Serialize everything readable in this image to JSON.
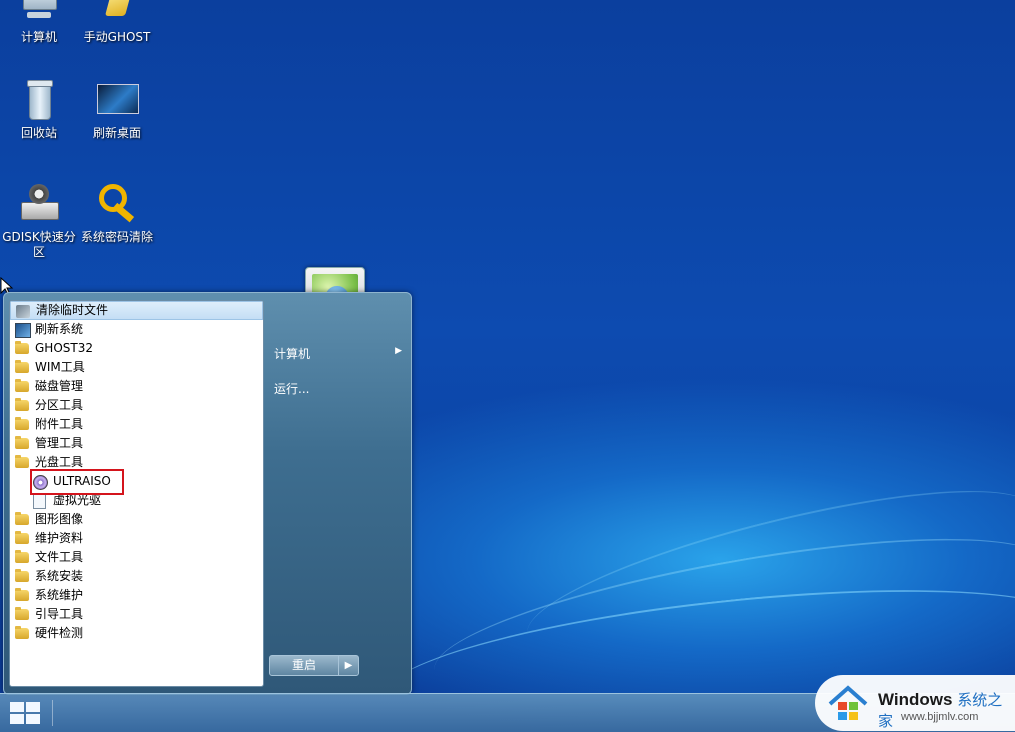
{
  "desktop": {
    "icons": [
      {
        "label": "计算机"
      },
      {
        "label": "手动GHOST"
      },
      {
        "label": "回收站"
      },
      {
        "label": "刷新桌面"
      },
      {
        "label": "GDISK快速分区"
      },
      {
        "label": "系统密码清除"
      }
    ]
  },
  "start_menu": {
    "programs": [
      {
        "label": "清除临时文件",
        "icon": "broom-icon",
        "highlighted": true
      },
      {
        "label": "刷新系统",
        "icon": "monitor-icon"
      },
      {
        "label": "GHOST32",
        "icon": "folder-icon"
      },
      {
        "label": "WIM工具",
        "icon": "folder-icon"
      },
      {
        "label": "磁盘管理",
        "icon": "folder-icon"
      },
      {
        "label": "分区工具",
        "icon": "folder-icon"
      },
      {
        "label": "附件工具",
        "icon": "folder-icon"
      },
      {
        "label": "管理工具",
        "icon": "folder-icon"
      },
      {
        "label": "光盘工具",
        "icon": "folder-icon"
      },
      {
        "label": "ULTRAISO",
        "icon": "disc-icon",
        "sub": true,
        "boxed": true
      },
      {
        "label": "虚拟光驱",
        "icon": "virtual-drive-icon",
        "sub": true
      },
      {
        "label": "图形图像",
        "icon": "folder-icon"
      },
      {
        "label": "维护资料",
        "icon": "folder-icon"
      },
      {
        "label": "文件工具",
        "icon": "folder-icon"
      },
      {
        "label": "系统安装",
        "icon": "folder-icon"
      },
      {
        "label": "系统维护",
        "icon": "folder-icon"
      },
      {
        "label": "引导工具",
        "icon": "folder-icon"
      },
      {
        "label": "硬件检测",
        "icon": "folder-icon"
      }
    ],
    "right_pane": {
      "computer": "计算机",
      "run": "运行..."
    },
    "restart_label": "重启",
    "restart_arrow": "▶",
    "computer_arrow": "▶"
  },
  "watermark": {
    "title": "Windows",
    "title_cn": "系统之家",
    "url": "www.bjjmlv.com"
  },
  "colors": {
    "highlight_box": "#d4141c",
    "desktop_blue": "#0b3f9e"
  }
}
